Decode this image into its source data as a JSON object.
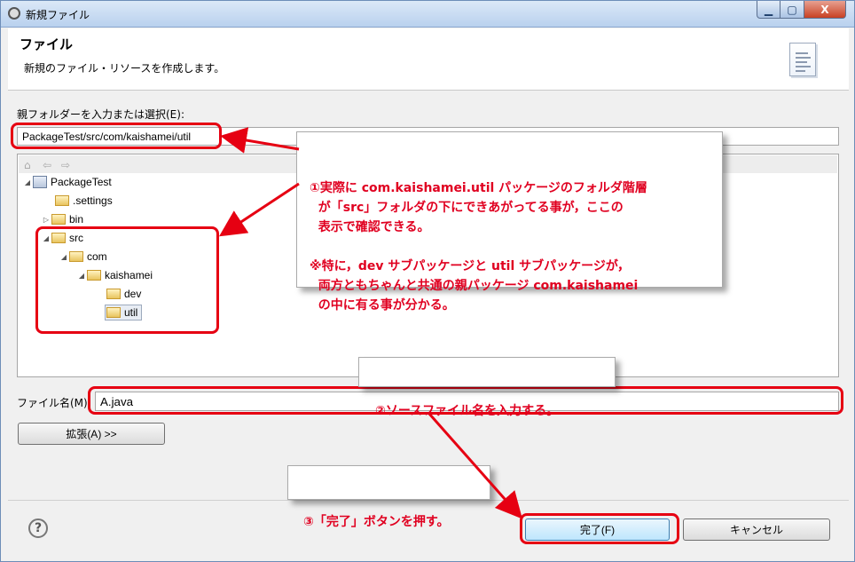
{
  "window": {
    "title": "新規ファイル",
    "min_label": "▁",
    "max_label": "▢",
    "close_label": "X"
  },
  "header": {
    "title": "ファイル",
    "description": "新規のファイル・リソースを作成します。",
    "icon": "document-icon"
  },
  "folder": {
    "label": "親フォルダーを入力または選択(E):",
    "value": "PackageTest/src/com/kaishamei/util"
  },
  "tree": {
    "toolbar_icons": [
      "home-icon",
      "back-icon",
      "forward-icon"
    ],
    "nodes": [
      {
        "label": "PackageTest",
        "icon": "project-icon",
        "expanded": true
      },
      {
        "label": ".settings",
        "icon": "folder-icon"
      },
      {
        "label": "bin",
        "icon": "folder-icon",
        "collapsed": true
      },
      {
        "label": "src",
        "icon": "folder-icon",
        "expanded": true
      },
      {
        "label": "com",
        "icon": "folder-icon",
        "expanded": true
      },
      {
        "label": "kaishamei",
        "icon": "folder-icon",
        "expanded": true
      },
      {
        "label": "dev",
        "icon": "folder-icon"
      },
      {
        "label": "util",
        "icon": "folder-icon",
        "selected": true
      }
    ]
  },
  "filename": {
    "label": "ファイル名(M):",
    "value": "A.java"
  },
  "buttons": {
    "advanced": "拡張(A) >>",
    "finish": "完了(F)",
    "cancel": "キャンセル",
    "help": "?"
  },
  "callouts": {
    "one": "①実際に com.kaishamei.util パッケージのフォルダ階層\n  が「src」フォルダの下にできあがってる事が，ここの\n  表示で確認できる。\n\n※特に，dev サブパッケージと util サブパッケージが，\n  両方ともちゃんと共通の親パッケージ com.kaishamei\n  の中に有る事が分かる。",
    "two": "②ソースファイル名を入力する。",
    "three": "③「完了」ボタンを押す。"
  },
  "colors": {
    "annotation": "#e60012",
    "window_border": "#6d8db8"
  }
}
